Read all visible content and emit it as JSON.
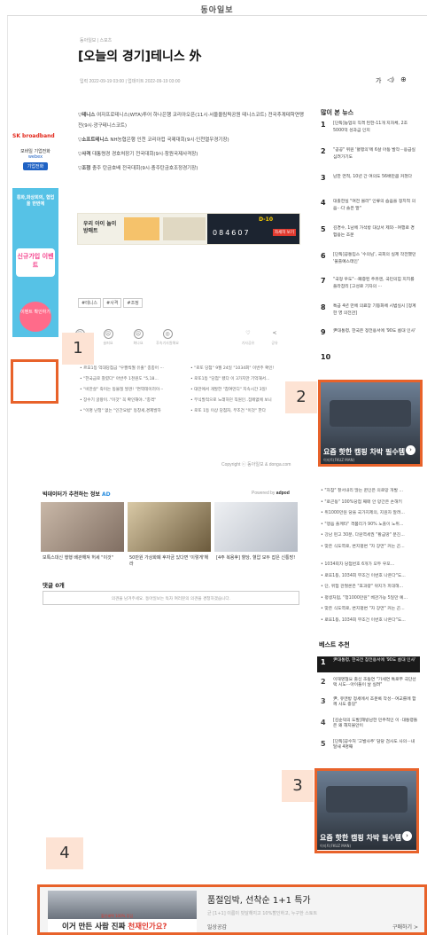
{
  "header": {
    "logo": "동아일보"
  },
  "article": {
    "breadcrumb": "동아일보 | 스포츠",
    "title": "[오늘의 경기]테니스 外",
    "dates": "입력 2022-09-19 03:00  |  업데이트 2022-09-19 03:00",
    "font_label": "가",
    "paragraphs": [
      {
        "sport": "▽테니스",
        "text": " 여자프로테니스(WTA)투어 하나은행 코리아오픈(11시·서울올림픽공원 테니스코트) 전국추계테학연맹전(9시·광구테니스코트)"
      },
      {
        "sport": "▽소프트테니스",
        "text": " NH농협은행 인천 코리아컵 국제대회(9시·인천열우경기장)"
      },
      {
        "sport": "▽사격",
        "text": " 대통령경 경호처장기 전국대회(9시·창원국제사격장)"
      },
      {
        "sport": "▽조정",
        "text": " 충주 탄금호배 전국대회(9시·충주탄금호조정경기장)"
      }
    ],
    "tags": [
      "#테니스",
      "#사격",
      "#조정"
    ],
    "reactions": [
      "좋아요",
      "슬퍼요",
      "화나요",
      "후속기사원해요",
      "기사공유",
      "공유"
    ],
    "related": [
      "• 르포1등 억대당첨금 \"우짤씩월 유출\" 충충어 ···",
      "• \"한국금로 찰렸다\" 아반주 1천원도 \"5,18...",
      "• \"비만살\" 죽이는 동물질 발견! \"면역테이러이···",
      "• 장수기 굴왕이..\"이것\" 꼭 확인해야..\"충격\"",
      "• \"이명 난청\" 없는 \"인간요법\" 동창세,경제발하"
    ],
    "related2": [
      "• \"로또 당첨\" 9월 24일 \"1034회\" 이번주 확인!",
      "• 로또1등 \"당첨\" 됐다 이 3가지만 기억해서...",
      "• 대만에서 개발한 \"참여먼디\" 지속시간 3일!",
      "• 무식발적으로 노래하던 직원인..집에없에 보니",
      "• 로또 1등 이상 당첨자, 무조건 \"이것\" 한다"
    ],
    "copyright": "Copyright ⓒ 동아일보 & donga.com"
  },
  "promo": {
    "title": "우리 아이 놀이방매트",
    "dday": "D-10",
    "digits": [
      "0",
      "8",
      "4",
      "6",
      "0",
      "7"
    ],
    "cta": "자세히 보기"
  },
  "left_ads": {
    "sk_brand": "SK broadband",
    "sk_line1": "모바일 기업전화",
    "sk_line2": "webex",
    "sk_btn": "기업전화",
    "cyan_top": "통화,화상회의, 협업을 한번에",
    "cyan_mid": "신규가입 이벤트",
    "cyan_bot": "이벤트 확인하기"
  },
  "annotations": [
    "1",
    "2",
    "3",
    "4"
  ],
  "sidebar": {
    "popular_title": "많이 본 뉴스",
    "popular": [
      "[단독]농업의 직격 된한-11개 지자체, 2조5000억 성과금 인지",
      "\"공공\" 위원 '혈맹의'에 6살 아동 발작···응급실 심려가기도",
      "남한 면적, 10년 간 여의도 56배만큼 커졌다",
      "대출한실 \"여전 몰라\" 인류의 숍음을 정치적 의음···다 솔은 말\"",
      "김경수, 1남에 가석방 대상서 제외···여행로 경험용는 조문",
      "[단독]공통입스 '수의님', 국회의 실제 작전했던 '불출예스테인'",
      "\"국정 우도\"···폐증된 주유엔, 국민의힘 지치를 플라잡리 [고성로 기자의 ···",
      "특급 4년 만에 의료장 기등화에 시범실시 [정계한 영 의전관]",
      "尹대통령, 한국은 정전용서에 '90도 룸대 인사'",
      ""
    ],
    "ad2_caption": "요즘 핫한 캠핑 차박 필수템",
    "ad2_src": "이지트(FKUZ MAN)",
    "links": [
      "• \"자참\" 잘서내리 많는 퀸인은 의로망 개발 ...",
      "• \"로곤동\" 100%당첨 째매 안 망간은 손해키",
      "• 위1000만원 당을 국가지제의, 지원자 알려...",
      "• \"맹음 플께타\" 격품리가 90% 노출이 노위...",
      "• 강남 펀고 30분, 다원역세권 \"황금땅\" 분진...",
      "• 맞은 식도역로, 변지평변 \"자 장면\" 커는 곤...",
      "",
      "• 1034회차 당첨번호 6개가 모두 우포...",
      "• 로또1등, 1034회 무조건 이번호 나온다\"도...",
      "• 단, 위험 관절론은 \"효과량\" 뀌지가 피대해...",
      "• 평생처럼, \"청1000만원\" 베관가능 5일만 예...",
      "• 맞은 식도역로, 변지평변 \"자 장면\" 커는 곤...",
      "• 로또1등, 1034회 무조건 이번호 나온다\"도..."
    ],
    "best_title": "베스트 추천",
    "best": [
      "尹대통령, 한국전 참전용서에 '90도 룸대 인사'",
      "이재명협요 출신 조동연 \"가세연 특로부 극단선택 시도···아이들이 날 실려\"",
      "尹, 유엔방 정세에서 조문록 작성···여교를에 함께 사도 중길\"",
      "[김순덕의 도발]해방남한 민주적인 이 ·대통령들은 왜 해지불안이",
      "[단독]공수처 '고발사주' 담당 검사도 사의···내달새 4명째"
    ],
    "ad3_caption": "요즘 핫한 캠핑 차박 필수템",
    "ad3_src": "이지트(FKUZ MAN)"
  },
  "recommend": {
    "title": "빅데이터가 추천하는 정보",
    "ad_label": "AD",
    "powered": "Powered by",
    "powered_brand": "adpod",
    "items": [
      "보톡스대신 행행 배관해져 허세 \"이것\"",
      "50만원 가상화폐 후자금 있다면 '이렇게'해라",
      "[4주 복용후] 혈당, 혈압 모두 잡은 신통방!",
      ""
    ]
  },
  "comments": {
    "title": "댓글 0개",
    "placeholder": "의견을 남겨주세요. 동아일보는 독자 여러분의 의견을 경청하겠습니다."
  },
  "bottom_ad": {
    "title": "품절임박, 선착순 1+1 특가",
    "desc": "균 [1+1] 이름이 빗달해지고 10%할인하고, 누구한 스토트",
    "left_text": "이거 만든 사람 진짜",
    "left_highlight": "천재인가요?",
    "left_small": "할인혜택 100% 투입",
    "shop": "일상공감",
    "cta": "구매하기 >"
  },
  "colors": {
    "accent": "#e8622a",
    "annotation_bg": "#fde3d4",
    "link_blue": "#1f62c4"
  }
}
